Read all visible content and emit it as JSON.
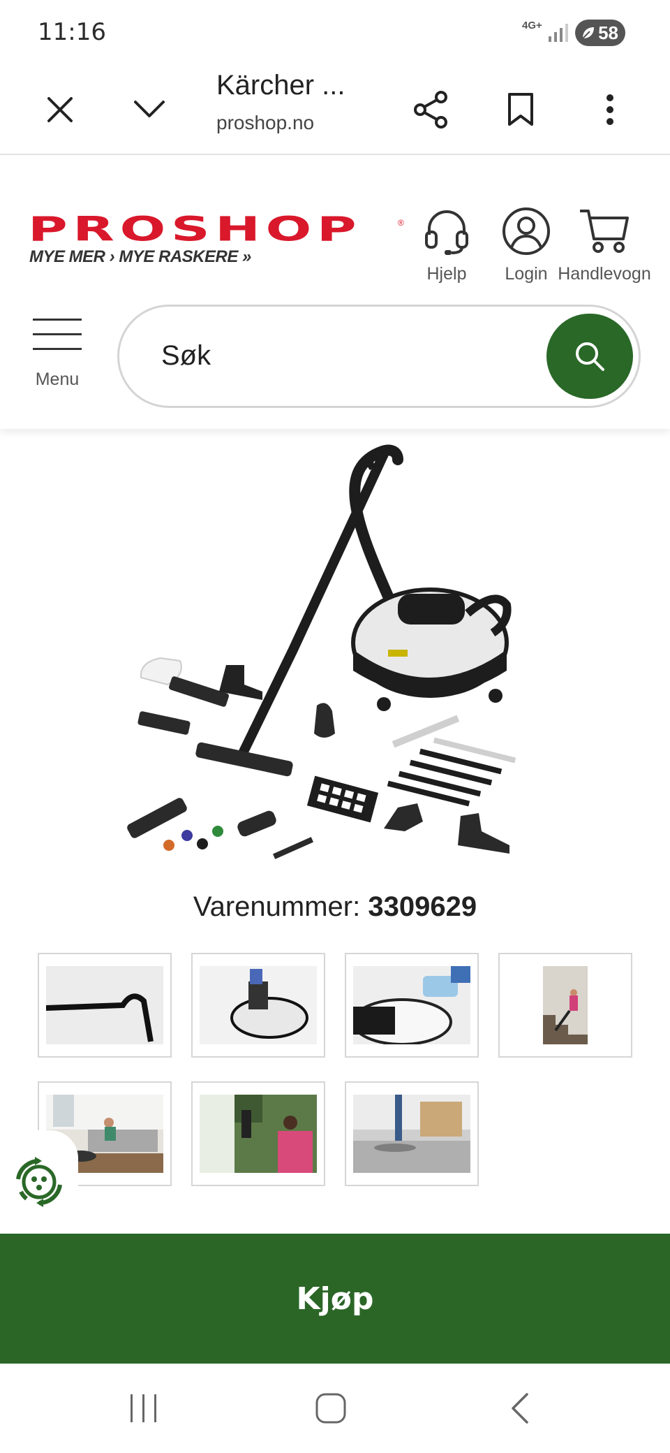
{
  "status_bar": {
    "time": "11:16",
    "network": "4G+",
    "battery": "58"
  },
  "browser": {
    "title": "Kärcher ...",
    "url": "proshop.no",
    "icons": [
      "close-icon",
      "chevron-down-icon",
      "share-icon",
      "bookmark-icon",
      "more-vertical-icon"
    ]
  },
  "header": {
    "logo_text": "PROSHOP",
    "logo_registered": "®",
    "tagline": "MYE MER › MYE RASKERE »",
    "help_label": "Hjelp",
    "login_label": "Login",
    "cart_label": "Handlevogn",
    "menu_label": "Menu",
    "brand_color": "#d9182b",
    "accent_color": "#2a6828"
  },
  "search": {
    "placeholder": "Søk"
  },
  "product": {
    "sku_label": "Varenummer:",
    "sku_value": "3309629",
    "image_alt": "steam-vacuum-with-accessories",
    "thumbnails": [
      "thumbnail-hose-handle",
      "thumbnail-refill-unit",
      "thumbnail-pouring-water",
      "thumbnail-stairs-cleaning",
      "thumbnail-living-room",
      "thumbnail-window-cleaning",
      "thumbnail-floor-cleaning"
    ]
  },
  "buy": {
    "label": "Kjøp"
  }
}
